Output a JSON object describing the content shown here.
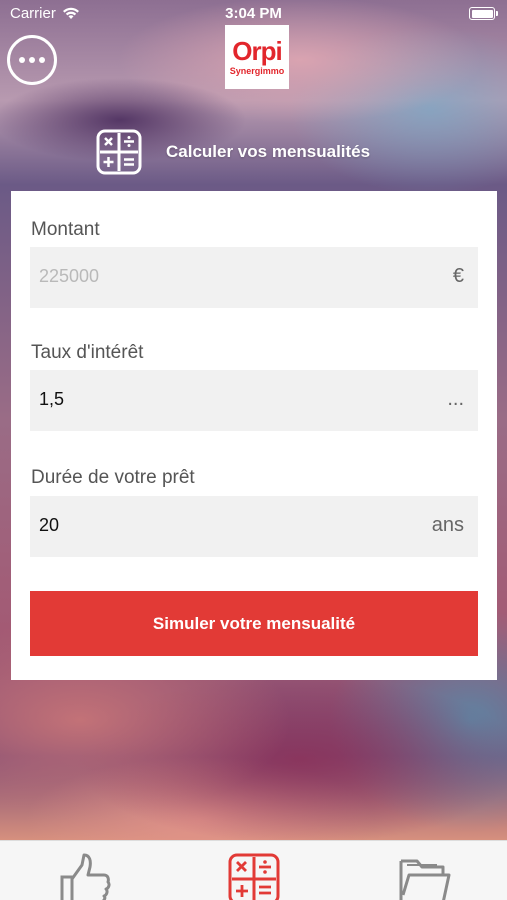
{
  "status_bar": {
    "carrier": "Carrier",
    "time": "3:04 PM"
  },
  "logo": {
    "main": "Orpi",
    "sub": "Synergimmo"
  },
  "header": {
    "title": "Calculer vos mensualités",
    "icon": "calculator-icon"
  },
  "form": {
    "amount": {
      "label": "Montant",
      "placeholder": "225000",
      "suffix": "€"
    },
    "rate": {
      "label": "Taux d'intérêt",
      "value": "1,5",
      "suffix": "..."
    },
    "duration": {
      "label": "Durée de votre prêt",
      "value": "20",
      "suffix": "ans"
    },
    "submit_label": "Simuler votre mensualité"
  },
  "tab_bar": {
    "tabs": [
      {
        "icon": "thumbs-up-icon"
      },
      {
        "icon": "calculator-icon",
        "active": true
      },
      {
        "icon": "folder-icon"
      }
    ]
  },
  "colors": {
    "accent": "#e23a36",
    "brand": "#e2262c"
  }
}
